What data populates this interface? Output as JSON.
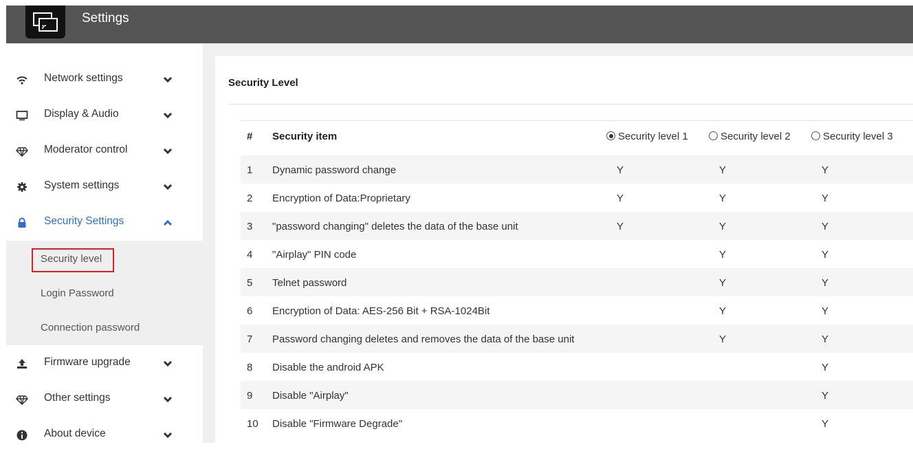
{
  "header": {
    "title": "Settings",
    "logo_icon": "screen-cast-icon"
  },
  "sidebar": {
    "items": [
      {
        "label": "Network settings",
        "icon": "wifi-icon",
        "expanded": false
      },
      {
        "label": "Display & Audio",
        "icon": "monitor-icon",
        "expanded": false
      },
      {
        "label": "Moderator control",
        "icon": "diamond-icon",
        "expanded": false
      },
      {
        "label": "System settings",
        "icon": "gear-icon",
        "expanded": false
      },
      {
        "label": "Security Settings",
        "icon": "lock-icon",
        "expanded": true,
        "active": true
      },
      {
        "label": "Firmware upgrade",
        "icon": "upload-icon",
        "expanded": false
      },
      {
        "label": "Other settings",
        "icon": "diamond-icon",
        "expanded": false
      },
      {
        "label": "About device",
        "icon": "info-icon",
        "expanded": false
      }
    ],
    "security_submenu": [
      {
        "label": "Security level",
        "selected": true
      },
      {
        "label": "Login Password"
      },
      {
        "label": "Connection password"
      }
    ]
  },
  "main": {
    "title": "Security Level",
    "table": {
      "col_no": "#",
      "col_item": "Security item",
      "levels": [
        {
          "label": "Security level 1",
          "checked": true
        },
        {
          "label": "Security level 2",
          "checked": false
        },
        {
          "label": "Security level 3",
          "checked": false
        }
      ],
      "rows": [
        {
          "no": "1",
          "item": "Dynamic password change",
          "l1": "Y",
          "l2": "Y",
          "l3": "Y"
        },
        {
          "no": "2",
          "item": "Encryption of Data:Proprietary",
          "l1": "Y",
          "l2": "Y",
          "l3": "Y"
        },
        {
          "no": "3",
          "item": "\"password changing\" deletes the data of the base unit",
          "l1": "Y",
          "l2": "Y",
          "l3": "Y"
        },
        {
          "no": "4",
          "item": "\"Airplay\" PIN code",
          "l1": "",
          "l2": "Y",
          "l3": "Y"
        },
        {
          "no": "5",
          "item": "Telnet password",
          "l1": "",
          "l2": "Y",
          "l3": "Y"
        },
        {
          "no": "6",
          "item": "Encryption of Data: AES-256 Bit + RSA-1024Bit",
          "l1": "",
          "l2": "Y",
          "l3": "Y"
        },
        {
          "no": "7",
          "item": "Password changing deletes and removes the data of the base unit",
          "l1": "",
          "l2": "Y",
          "l3": "Y"
        },
        {
          "no": "8",
          "item": "Disable the android APK",
          "l1": "",
          "l2": "",
          "l3": "Y"
        },
        {
          "no": "9",
          "item": "Disable \"Airplay\"",
          "l1": "",
          "l2": "",
          "l3": "Y"
        },
        {
          "no": "10",
          "item": "Disable \"Firmware Degrade\"",
          "l1": "",
          "l2": "",
          "l3": "Y"
        }
      ]
    }
  },
  "colors": {
    "header_bg": "#545454",
    "active": "#2f6fc8",
    "highlight_border": "#e02020"
  }
}
